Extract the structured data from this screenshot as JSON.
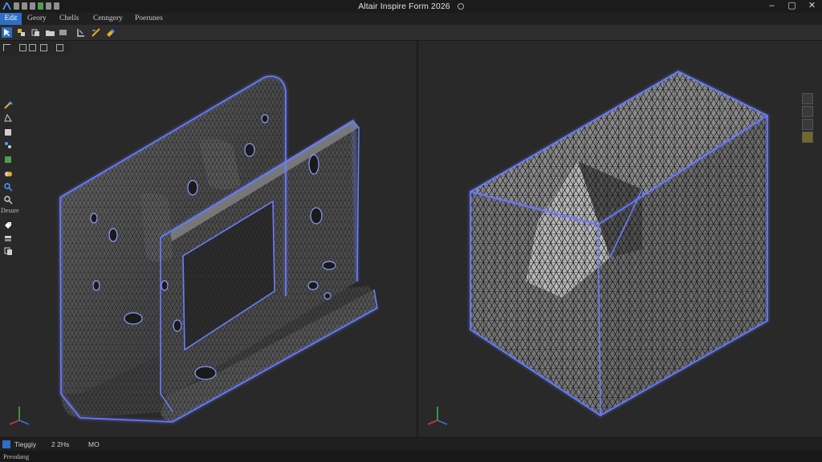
{
  "window": {
    "title": "Altair Inspire Form 2026",
    "controls": {
      "minimize": "–",
      "maximize": "▢",
      "close": "✕"
    }
  },
  "menu": {
    "tabs": [
      {
        "label": "Edit",
        "active": true
      },
      {
        "label": "Geory",
        "active": false
      },
      {
        "label": "Chells",
        "active": false
      },
      {
        "label": "Cenngery",
        "active": false
      },
      {
        "label": "Poerunes",
        "active": false
      }
    ]
  },
  "left_panel": {
    "section_label": "Desure"
  },
  "status": {
    "item1": "Tieggiy",
    "item2": "2 2Hs",
    "item3": "MO",
    "footer": "Preodang"
  },
  "colors": {
    "accent": "#2c6fc4",
    "mesh_highlight": "#6b7cff",
    "axis_x": "#d23b3b",
    "axis_y": "#3fb84a",
    "axis_z": "#3f6fe0"
  }
}
